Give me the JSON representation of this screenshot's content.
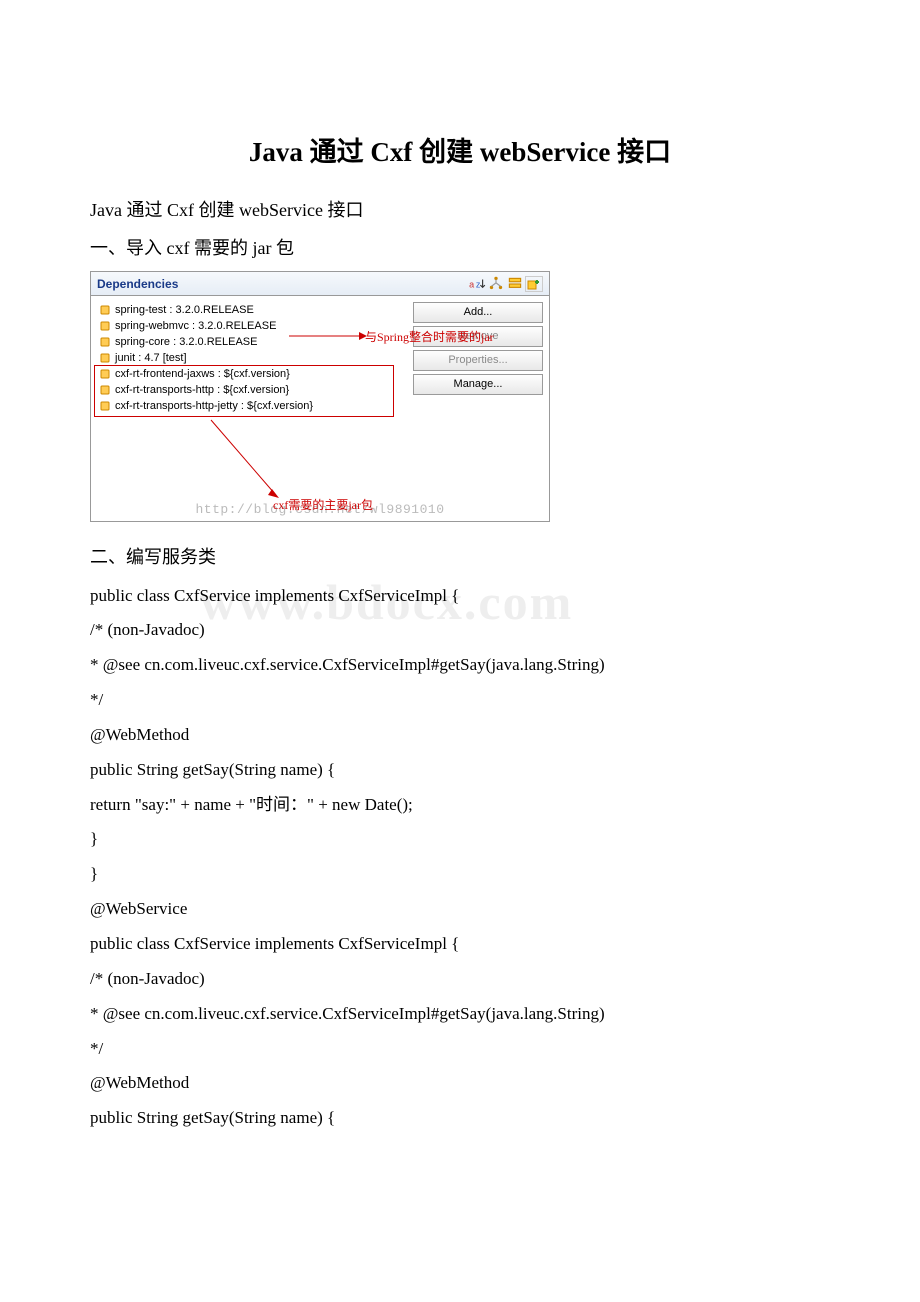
{
  "doc_title": "Java 通过 Cxf 创建 webService 接口",
  "intro": "Java 通过 Cxf 创建 webService 接口",
  "section1": "一、导入 cxf 需要的 jar 包",
  "panel": {
    "title": "Dependencies",
    "deps": [
      "spring-test : 3.2.0.RELEASE",
      "spring-webmvc : 3.2.0.RELEASE",
      "spring-core : 3.2.0.RELEASE",
      "junit : 4.7 [test]",
      "cxf-rt-frontend-jaxws : ${cxf.version}",
      "cxf-rt-transports-http : ${cxf.version}",
      "cxf-rt-transports-http-jetty : ${cxf.version}"
    ],
    "buttons": {
      "add": "Add...",
      "remove": "Remove",
      "properties": "Properties...",
      "manage": "Manage..."
    },
    "annotation_spring": "与Spring整合时需要的jar",
    "annotation_jar": "cxf需要的主要jar包",
    "watermark_url": "http://blog.csdn.net/wl9891010"
  },
  "section2": "二、编写服务类",
  "watermark_big": "www.bdocx.com",
  "code": {
    "l1": "public class CxfService implements CxfServiceImpl {",
    "l2": "/* (non-Javadoc)",
    "l3": " * @see cn.com.liveuc.cxf.service.CxfServiceImpl#getSay(java.lang.String)",
    "l4": " */",
    "l5": " @WebMethod",
    "l6": " public String getSay(String name) {",
    "l7": " return \"say:\" + name + \"时间：\" + new Date();",
    "l8": " }",
    "l9": "}",
    "l10": "@WebService",
    "l11": "public class CxfService implements CxfServiceImpl {",
    "l12": "/* (non-Javadoc)",
    "l13": " * @see cn.com.liveuc.cxf.service.CxfServiceImpl#getSay(java.lang.String)",
    "l14": " */",
    "l15": " @WebMethod",
    "l16": " public String getSay(String name) {"
  }
}
